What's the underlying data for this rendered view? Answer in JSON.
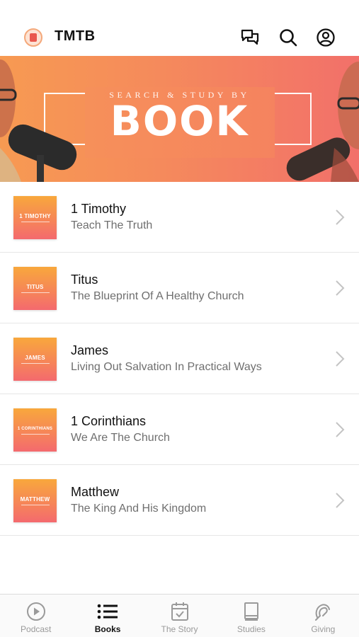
{
  "header": {
    "title": "TMTB",
    "icons": [
      "chat-icon",
      "search-icon",
      "account-icon"
    ]
  },
  "banner": {
    "subtitle": "SEARCH & STUDY BY",
    "headline": "BOOK",
    "gradient": [
      "#f79a52",
      "#f2706a"
    ]
  },
  "books": [
    {
      "title": "1 Timothy",
      "subtitle": "Teach The Truth",
      "thumb_text": "1 TIMOTHY"
    },
    {
      "title": "Titus",
      "subtitle": "The Blueprint Of A Healthy Church",
      "thumb_text": "TITUS"
    },
    {
      "title": "James",
      "subtitle": "Living Out Salvation In Practical Ways",
      "thumb_text": "JAMES"
    },
    {
      "title": "1 Corinthians",
      "subtitle": "We Are The Church",
      "thumb_text": "1 CORINTHIANS"
    },
    {
      "title": "Matthew",
      "subtitle": "The King And His Kingdom",
      "thumb_text": "MATTHEW"
    }
  ],
  "tabs": [
    {
      "label": "Podcast",
      "icon": "play-circle-icon",
      "active": false
    },
    {
      "label": "Books",
      "icon": "list-icon",
      "active": true
    },
    {
      "label": "The Story",
      "icon": "calendar-check-icon",
      "active": false
    },
    {
      "label": "Studies",
      "icon": "book-icon",
      "active": false
    },
    {
      "label": "Giving",
      "icon": "giving-icon",
      "active": false
    }
  ],
  "colors": {
    "accent": "#f47a62",
    "active_tab": "#111111",
    "inactive_tab": "#9a9a9a"
  }
}
